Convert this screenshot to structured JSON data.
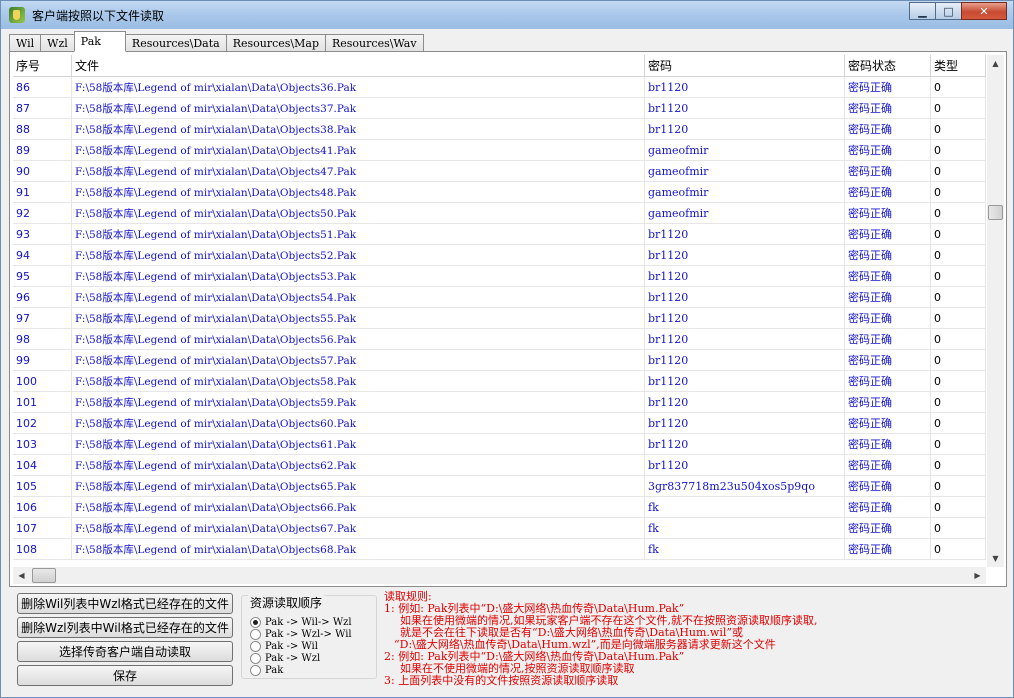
{
  "window": {
    "title": "客户端按照以下文件读取",
    "minimize": "▁",
    "maximize": "□",
    "close": "✕"
  },
  "tabs": [
    "Wil",
    "Wzl",
    "Pak",
    "Resources\\Data",
    "Resources\\Map",
    "Resources\\Wav"
  ],
  "active_tab": "Pak",
  "table": {
    "headers": [
      "序号",
      "文件",
      "密码",
      "密码状态",
      "类型"
    ],
    "rows": [
      [
        "86",
        "F:\\58版本库\\Legend of mir\\xialan\\Data\\Objects36.Pak",
        "br1120",
        "密码正确",
        "0"
      ],
      [
        "87",
        "F:\\58版本库\\Legend of mir\\xialan\\Data\\Objects37.Pak",
        "br1120",
        "密码正确",
        "0"
      ],
      [
        "88",
        "F:\\58版本库\\Legend of mir\\xialan\\Data\\Objects38.Pak",
        "br1120",
        "密码正确",
        "0"
      ],
      [
        "89",
        "F:\\58版本库\\Legend of mir\\xialan\\Data\\Objects41.Pak",
        "gameofmir",
        "密码正确",
        "0"
      ],
      [
        "90",
        "F:\\58版本库\\Legend of mir\\xialan\\Data\\Objects47.Pak",
        "gameofmir",
        "密码正确",
        "0"
      ],
      [
        "91",
        "F:\\58版本库\\Legend of mir\\xialan\\Data\\Objects48.Pak",
        "gameofmir",
        "密码正确",
        "0"
      ],
      [
        "92",
        "F:\\58版本库\\Legend of mir\\xialan\\Data\\Objects50.Pak",
        "gameofmir",
        "密码正确",
        "0"
      ],
      [
        "93",
        "F:\\58版本库\\Legend of mir\\xialan\\Data\\Objects51.Pak",
        "br1120",
        "密码正确",
        "0"
      ],
      [
        "94",
        "F:\\58版本库\\Legend of mir\\xialan\\Data\\Objects52.Pak",
        "br1120",
        "密码正确",
        "0"
      ],
      [
        "95",
        "F:\\58版本库\\Legend of mir\\xialan\\Data\\Objects53.Pak",
        "br1120",
        "密码正确",
        "0"
      ],
      [
        "96",
        "F:\\58版本库\\Legend of mir\\xialan\\Data\\Objects54.Pak",
        "br1120",
        "密码正确",
        "0"
      ],
      [
        "97",
        "F:\\58版本库\\Legend of mir\\xialan\\Data\\Objects55.Pak",
        "br1120",
        "密码正确",
        "0"
      ],
      [
        "98",
        "F:\\58版本库\\Legend of mir\\xialan\\Data\\Objects56.Pak",
        "br1120",
        "密码正确",
        "0"
      ],
      [
        "99",
        "F:\\58版本库\\Legend of mir\\xialan\\Data\\Objects57.Pak",
        "br1120",
        "密码正确",
        "0"
      ],
      [
        "100",
        "F:\\58版本库\\Legend of mir\\xialan\\Data\\Objects58.Pak",
        "br1120",
        "密码正确",
        "0"
      ],
      [
        "101",
        "F:\\58版本库\\Legend of mir\\xialan\\Data\\Objects59.Pak",
        "br1120",
        "密码正确",
        "0"
      ],
      [
        "102",
        "F:\\58版本库\\Legend of mir\\xialan\\Data\\Objects60.Pak",
        "br1120",
        "密码正确",
        "0"
      ],
      [
        "103",
        "F:\\58版本库\\Legend of mir\\xialan\\Data\\Objects61.Pak",
        "br1120",
        "密码正确",
        "0"
      ],
      [
        "104",
        "F:\\58版本库\\Legend of mir\\xialan\\Data\\Objects62.Pak",
        "br1120",
        "密码正确",
        "0"
      ],
      [
        "105",
        "F:\\58版本库\\Legend of mir\\xialan\\Data\\Objects65.Pak",
        "3gr837718m23u504xos5p9qo",
        "密码正确",
        "0"
      ],
      [
        "106",
        "F:\\58版本库\\Legend of mir\\xialan\\Data\\Objects66.Pak",
        "fk",
        "密码正确",
        "0"
      ],
      [
        "107",
        "F:\\58版本库\\Legend of mir\\xialan\\Data\\Objects67.Pak",
        "fk",
        "密码正确",
        "0"
      ],
      [
        "108",
        "F:\\58版本库\\Legend of mir\\xialan\\Data\\Objects68.Pak",
        "fk",
        "密码正确",
        "0"
      ]
    ]
  },
  "buttons": {
    "delete_wil": "删除Wil列表中Wzl格式已经存在的文件",
    "delete_wzl": "删除Wzl列表中Wil格式已经存在的文件",
    "auto_read": "选择传奇客户端自动读取",
    "save": "保存"
  },
  "resource_order": {
    "title": "资源读取顺序",
    "options": [
      "Pak -> Wil-> Wzl",
      "Pak -> Wzl-> Wil",
      "Pak -> Wil",
      "Pak -> Wzl",
      "Pak"
    ],
    "selected_index": 0
  },
  "rules": [
    "读取规则:",
    "1: 例如: Pak列表中“D:\\盛大网络\\热血传奇\\Data\\Hum.Pak”",
    "如果在使用微端的情况,如果玩家客户端不存在这个文件,就不在按照资源读取顺序读取,",
    "就是不会在往下读取是否有“D:\\盛大网络\\热血传奇\\Data\\Hum.wil”或",
    "“D:\\盛大网络\\热血传奇\\Data\\Hum.wzl”,而是向微端服务器请求更新这个文件",
    "2: 例如: Pak列表中“D:\\盛大网络\\热血传奇\\Data\\Hum.Pak”",
    "如果在不使用微端的情况,按照资源读取顺序读取",
    "3: 上面列表中没有的文件按照资源读取顺序读取"
  ]
}
